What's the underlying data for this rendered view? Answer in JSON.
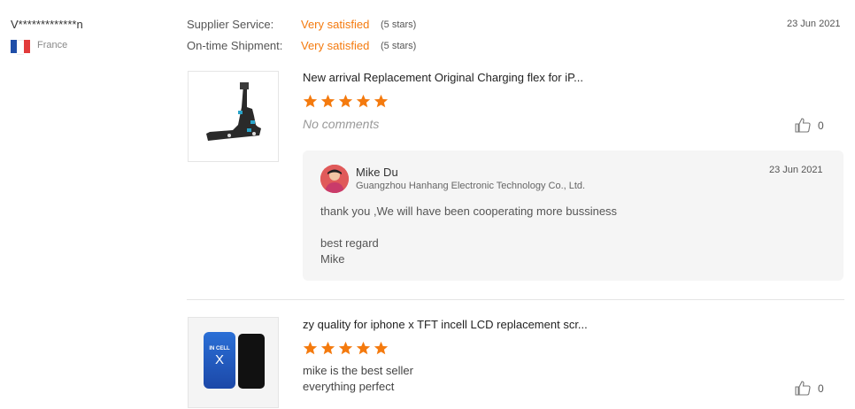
{
  "reviewer": {
    "name": "V*************n",
    "country": "France",
    "flag_colors": [
      "#1f4ea8",
      "#ffffff",
      "#e23b3b"
    ]
  },
  "ratings": [
    {
      "label": "Supplier Service:",
      "value": "Very satisfied",
      "stars": "(5 stars)"
    },
    {
      "label": "On-time Shipment:",
      "value": "Very satisfied",
      "stars": "(5 stars)"
    }
  ],
  "review_date": "23 Jun 2021",
  "accent_color": "#f47a0e",
  "products": [
    {
      "title": "New arrival Replacement Original Charging flex for iP...",
      "star_count": 5,
      "comment": "No comments",
      "like_count": "0",
      "reply": {
        "name": "Mike Du",
        "company": "Guangzhou Hanhang Electronic Technology Co., Ltd.",
        "date": "23 Jun 2021",
        "text_line1": "thank you ,We will have been cooperating more bussiness",
        "text_line2": "best regard",
        "text_line3": "Mike"
      }
    },
    {
      "title": "zy quality for iphone x TFT incell LCD replacement scr...",
      "star_count": 5,
      "comment_line1": "mike is the best seller",
      "comment_line2": "everything perfect",
      "like_count": "0",
      "thumb_text_line1": "IN CELL",
      "thumb_text_line2": "X"
    }
  ],
  "icons": {
    "star": "star-icon",
    "like": "thumbs-up-icon"
  }
}
